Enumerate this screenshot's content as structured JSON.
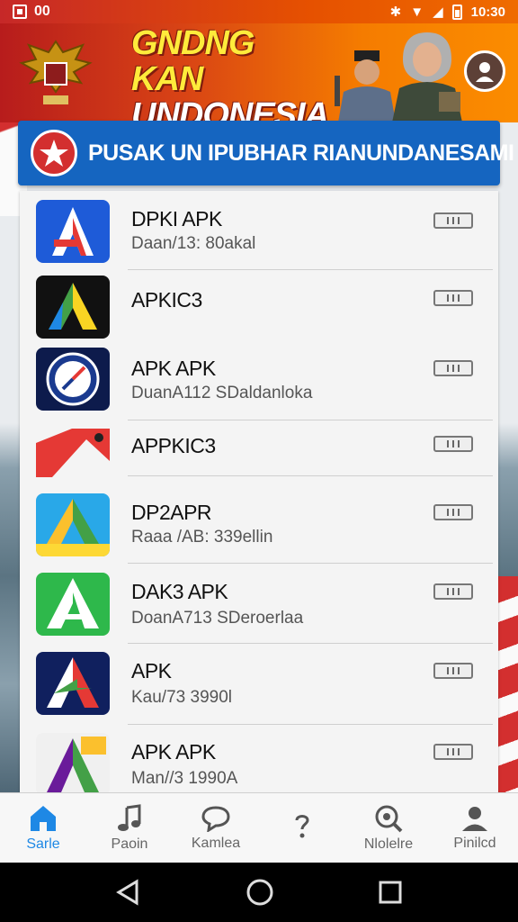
{
  "status_bar": {
    "left_text": "00",
    "time": "10:30"
  },
  "banner": {
    "title_line1": "GNDNG KAN",
    "title_line2": "UNDONESIA"
  },
  "title_bar": {
    "left_text": "PUSAK UN IPUBHAR RIAN",
    "right_text": "UNDANESAMI"
  },
  "apps": [
    {
      "name": "DPKI APK",
      "subtitle": "Daan/13: 80akal",
      "icon": "red-a-logo-icon"
    },
    {
      "name": "APKIC3",
      "subtitle": "",
      "icon": "green-yellow-a-logo-icon"
    },
    {
      "name": "APK APK",
      "subtitle": "DuanA112 SDaldanloka",
      "icon": "compass-badge-icon"
    },
    {
      "name": "APPKIC3",
      "subtitle": "",
      "icon": "red-ribbon-icon"
    },
    {
      "name": "DP2APR",
      "subtitle": "Raaa /AB: 339ellin",
      "icon": "yellow-blue-a-logo-icon"
    },
    {
      "name": "DAK3 APK",
      "subtitle": "DoanA713 SDeroerlaa",
      "icon": "green-a-logo-icon"
    },
    {
      "name": "APK",
      "subtitle": "Kau/73 3990l",
      "icon": "navy-a-logo-icon"
    },
    {
      "name": "APK APK",
      "subtitle": "Man//3 1990A",
      "icon": "purple-green-a-logo-icon"
    }
  ],
  "bottom_nav": [
    {
      "label": "Sarle",
      "icon": "home-icon",
      "active": true
    },
    {
      "label": "Paoin",
      "icon": "music-icon",
      "active": false
    },
    {
      "label": "Kamlea",
      "icon": "chat-bubble-icon",
      "active": false
    },
    {
      "label": "",
      "icon": "question-icon",
      "active": false
    },
    {
      "label": "Nlolelre",
      "icon": "search-icon",
      "active": false
    },
    {
      "label": "Pinilcd",
      "icon": "profile-icon",
      "active": false
    }
  ],
  "colors": {
    "accent": "#1e88e5",
    "title_bar": "#1565c0",
    "banner_start": "#b71c1c",
    "banner_end": "#fb8c00"
  }
}
